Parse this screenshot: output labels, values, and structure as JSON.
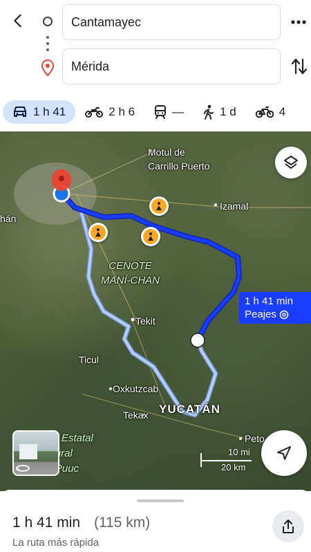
{
  "header": {
    "origin_value": "Cantamayec",
    "destination_value": "Mérida"
  },
  "modes": [
    {
      "icon": "car-icon",
      "label": "1 h 41",
      "active": true
    },
    {
      "icon": "motorcycle-icon",
      "label": "2 h 6"
    },
    {
      "icon": "train-icon",
      "label": "—"
    },
    {
      "icon": "walk-icon",
      "label": "1 d"
    },
    {
      "icon": "bike-icon",
      "label": "4"
    }
  ],
  "map": {
    "labels": {
      "motul": "Motul de\nCarrillo Puerto",
      "izamal": "Izamal",
      "han": "hán",
      "cenote": "CENOTE\nMANÍ-CHAN",
      "tekit": "Tekit",
      "ticul": "Ticul",
      "oxkutzcab": "Oxkutzcab",
      "tekax": "Tekax",
      "yucatan": "YUCATÁN",
      "peto": "Peto",
      "reserve": "rva Estatal\nultural\nel Puuc"
    },
    "callout": {
      "time": "1 h 41 min",
      "tolls": "Peajes"
    },
    "scale": {
      "mi": "10 mi",
      "km": "20 km"
    },
    "colors": {
      "primary_route": "#1a3cff",
      "alt_route": "#a9c4f5",
      "destination_pin": "#ea4335",
      "origin_dot": "#1a73e8",
      "roadwork": "#f9a825"
    }
  },
  "sheet": {
    "duration": "1 h 41 min",
    "distance": "(115 km)",
    "subtitle": "La ruta más rápida"
  }
}
